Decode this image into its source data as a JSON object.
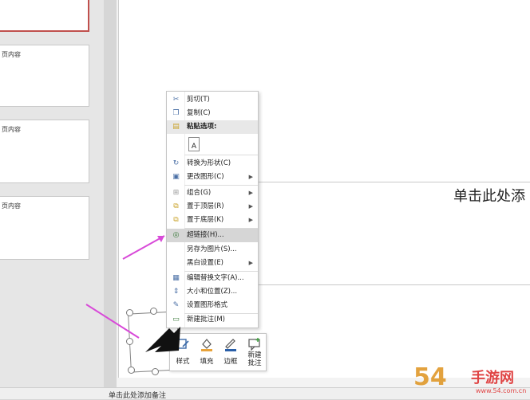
{
  "thumbnails": [
    {
      "text": ""
    },
    {
      "text": "页内容"
    },
    {
      "text": "页内容"
    },
    {
      "text": "页内容"
    }
  ],
  "slide": {
    "placeholder": "单击此处添"
  },
  "context_menu": {
    "items": [
      {
        "label": "剪切(T)",
        "icon": "scissors-icon",
        "glyph": "✂"
      },
      {
        "label": "复制(C)",
        "icon": "copy-icon",
        "glyph": "❐"
      },
      {
        "label": "粘贴选项:",
        "icon": "paste-icon",
        "glyph": "📋"
      },
      {
        "label": "A",
        "icon": "paste-keep-text-icon"
      },
      {
        "label": "转换为形状(C)",
        "icon": "convert-shape-icon",
        "glyph": "↻"
      },
      {
        "label": "更改图形(C)",
        "icon": "change-shape-icon",
        "glyph": "▣"
      },
      {
        "label": "组合(G)",
        "icon": "group-icon",
        "glyph": "⊞"
      },
      {
        "label": "置于顶层(R)",
        "icon": "bring-to-front-icon",
        "glyph": "⧉"
      },
      {
        "label": "置于底层(K)",
        "icon": "send-to-back-icon",
        "glyph": "⧉"
      },
      {
        "label": "超链接(H)...",
        "icon": "hyperlink-icon",
        "glyph": "🌐"
      },
      {
        "label": "另存为图片(S)...",
        "icon": "save-picture-icon"
      },
      {
        "label": "黑白设置(E)",
        "icon": "bw-settings-icon"
      },
      {
        "label": "编辑替换文字(A)...",
        "icon": "alt-text-icon",
        "glyph": "▦"
      },
      {
        "label": "大小和位置(Z)...",
        "icon": "size-position-icon",
        "glyph": "⇕"
      },
      {
        "label": "设置图形格式",
        "icon": "format-shape-icon",
        "glyph": "✎"
      },
      {
        "label": "新建批注(M)",
        "icon": "new-comment-icon",
        "glyph": "💬"
      }
    ]
  },
  "mini_toolbar": {
    "style_label": "样式",
    "fill_label": "填充",
    "border_label": "边框",
    "comment_label_1": "新建",
    "comment_label_2": "批注"
  },
  "notes": {
    "placeholder": "单击此处添加备注"
  },
  "colors": {
    "accent_arrow": "#d84ad8",
    "active_thumb_border": "#c0504d"
  },
  "watermark": {
    "main": "54",
    "site": "手游网",
    "url": "www.54.com.cn"
  }
}
